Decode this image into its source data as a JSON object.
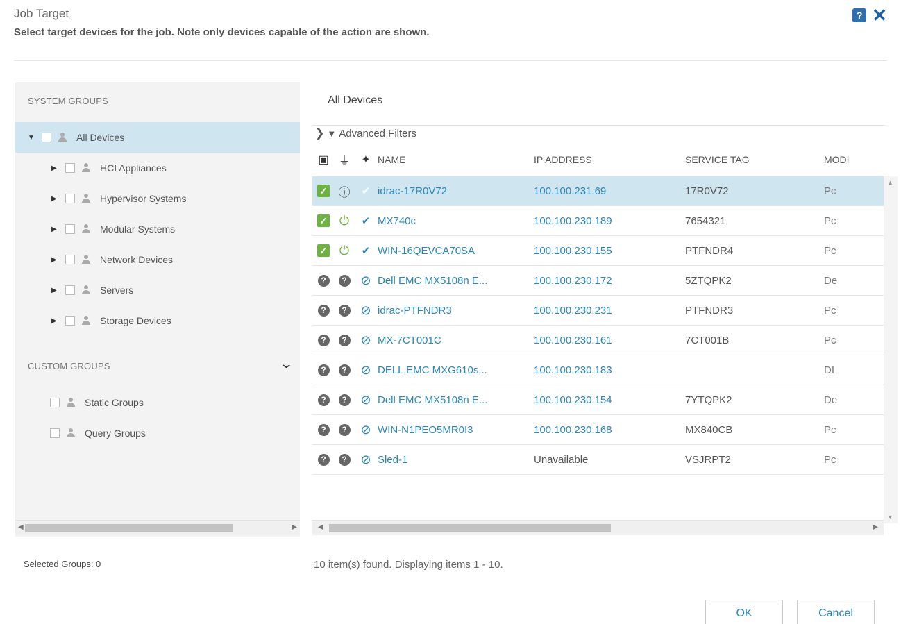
{
  "dialog": {
    "title": "Job Target",
    "subtitle": "Select target devices for the job. Note only devices capable of the action are shown.",
    "help_icon": "help-icon",
    "close_icon": "close-icon"
  },
  "system_groups": {
    "title": "SYSTEM GROUPS",
    "items": [
      {
        "label": "All Devices",
        "selected": true
      },
      {
        "label": "HCI Appliances"
      },
      {
        "label": "Hypervisor Systems"
      },
      {
        "label": "Modular Systems"
      },
      {
        "label": "Network Devices"
      },
      {
        "label": "Servers"
      },
      {
        "label": "Storage Devices"
      }
    ]
  },
  "custom_groups": {
    "title": "CUSTOM GROUPS",
    "items": [
      {
        "label": "Static Groups"
      },
      {
        "label": "Query Groups"
      }
    ]
  },
  "devices": {
    "tab_label": "All Devices",
    "advanced_filters": "Advanced Filters",
    "columns": [
      "NAME",
      "IP ADDRESS",
      "SERVICE TAG",
      "MODI"
    ],
    "rows": [
      {
        "checked": true,
        "power": "unknown",
        "status": "ok-faded",
        "name": "idrac-17R0V72",
        "ip": "100.100.231.69",
        "tag": "17R0V72",
        "model": "Pc",
        "selected": true
      },
      {
        "checked": true,
        "power": "on",
        "status": "ok",
        "name": "MX740c",
        "ip": "100.100.230.189",
        "tag": "7654321",
        "model": "Pc"
      },
      {
        "checked": true,
        "power": "on",
        "status": "ok",
        "name": "WIN-16QEVCA70SA",
        "ip": "100.100.230.155",
        "tag": "PTFNDR4",
        "model": "Pc"
      },
      {
        "checked": false,
        "power": "help",
        "status": "na",
        "name": "Dell EMC MX5108n E...",
        "ip": "100.100.230.172",
        "tag": "5ZTQPK2",
        "model": "De"
      },
      {
        "checked": false,
        "power": "help",
        "status": "na",
        "name": "idrac-PTFNDR3",
        "ip": "100.100.230.231",
        "tag": "PTFNDR3",
        "model": "Pc"
      },
      {
        "checked": false,
        "power": "help",
        "status": "na",
        "name": "MX-7CT001C",
        "ip": "100.100.230.161",
        "tag": "7CT001B",
        "model": "Pc"
      },
      {
        "checked": false,
        "power": "help",
        "status": "na",
        "name": "DELL EMC MXG610s...",
        "ip": "100.100.230.183",
        "tag": "",
        "model": "DI"
      },
      {
        "checked": false,
        "power": "help",
        "status": "na",
        "name": "Dell EMC MX5108n E...",
        "ip": "100.100.230.154",
        "tag": "7YTQPK2",
        "model": "De"
      },
      {
        "checked": false,
        "power": "help",
        "status": "na",
        "name": "WIN-N1PEO5MR0I3",
        "ip": "100.100.230.168",
        "tag": "MX840CB",
        "model": "Pc"
      },
      {
        "checked": false,
        "power": "help",
        "status": "na",
        "name": "Sled-1",
        "ip": "Unavailable",
        "tag": "VSJRPT2",
        "model": "Pc"
      }
    ]
  },
  "footer": {
    "selected_groups": "Selected Groups: 0",
    "count_text": "10 item(s) found. Displaying items 1 - 10.",
    "ok_label": "OK",
    "cancel_label": "Cancel"
  }
}
